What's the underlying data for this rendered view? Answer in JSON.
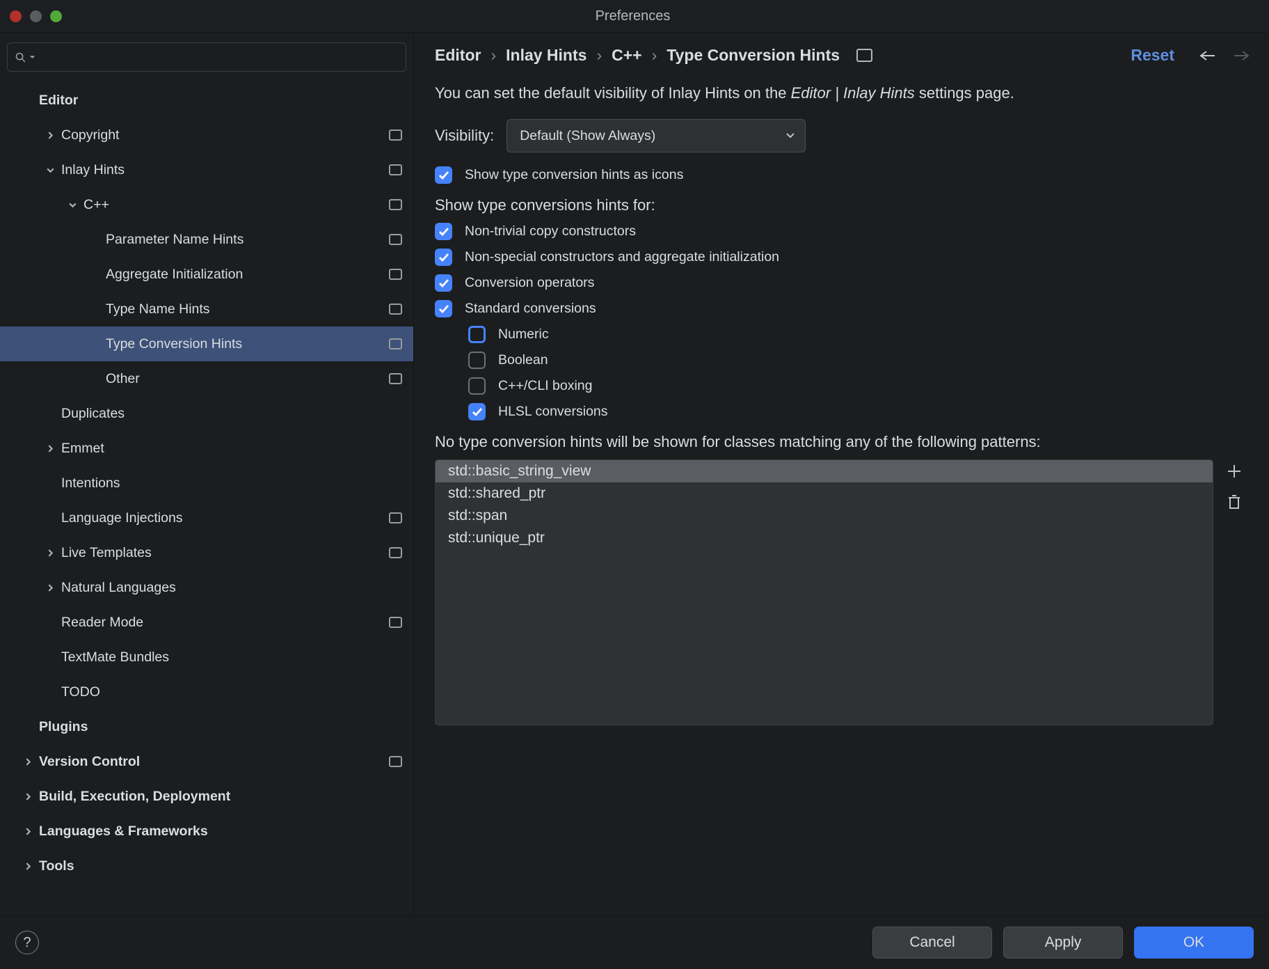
{
  "window": {
    "title": "Preferences"
  },
  "sidebar": {
    "search_placeholder": "",
    "items": [
      {
        "label": "Editor",
        "bold": true,
        "indent": 1,
        "chevron": "none"
      },
      {
        "label": "Copyright",
        "indent": 2,
        "chevron": "right",
        "mod": true
      },
      {
        "label": "Inlay Hints",
        "indent": 2,
        "chevron": "down",
        "mod": true
      },
      {
        "label": "C++",
        "indent": 3,
        "chevron": "down",
        "mod": true
      },
      {
        "label": "Parameter Name Hints",
        "indent": 4,
        "chevron": "none",
        "mod": true
      },
      {
        "label": "Aggregate Initialization",
        "indent": 4,
        "chevron": "none",
        "mod": true
      },
      {
        "label": "Type Name Hints",
        "indent": 4,
        "chevron": "none",
        "mod": true
      },
      {
        "label": "Type Conversion Hints",
        "indent": 4,
        "chevron": "none",
        "mod": true,
        "selected": true
      },
      {
        "label": "Other",
        "indent": 4,
        "chevron": "none",
        "mod": true
      },
      {
        "label": "Duplicates",
        "indent": 2,
        "chevron": "none"
      },
      {
        "label": "Emmet",
        "indent": 2,
        "chevron": "right"
      },
      {
        "label": "Intentions",
        "indent": 2,
        "chevron": "none"
      },
      {
        "label": "Language Injections",
        "indent": 2,
        "chevron": "none",
        "mod": true
      },
      {
        "label": "Live Templates",
        "indent": 2,
        "chevron": "right",
        "mod": true
      },
      {
        "label": "Natural Languages",
        "indent": 2,
        "chevron": "right"
      },
      {
        "label": "Reader Mode",
        "indent": 2,
        "chevron": "none",
        "mod": true
      },
      {
        "label": "TextMate Bundles",
        "indent": 2,
        "chevron": "none"
      },
      {
        "label": "TODO",
        "indent": 2,
        "chevron": "none"
      },
      {
        "label": "Plugins",
        "bold": true,
        "indent": 1,
        "chevron": "none"
      },
      {
        "label": "Version Control",
        "bold": true,
        "indent": 1,
        "chevron": "right",
        "mod": true
      },
      {
        "label": "Build, Execution, Deployment",
        "bold": true,
        "indent": 1,
        "chevron": "right"
      },
      {
        "label": "Languages & Frameworks",
        "bold": true,
        "indent": 1,
        "chevron": "right"
      },
      {
        "label": "Tools",
        "bold": true,
        "indent": 1,
        "chevron": "right"
      }
    ]
  },
  "breadcrumb": [
    "Editor",
    "Inlay Hints",
    "C++",
    "Type Conversion Hints"
  ],
  "reset": "Reset",
  "content": {
    "desc_pre": "You can set the default visibility of Inlay Hints on the ",
    "desc_em": "Editor | Inlay Hints",
    "desc_post": " settings page.",
    "visibility_label": "Visibility:",
    "visibility_value": "Default (Show Always)",
    "show_icons": "Show type conversion hints as icons",
    "show_for": "Show type conversions hints for:",
    "checks": [
      {
        "label": "Non-trivial copy constructors",
        "on": true
      },
      {
        "label": "Non-special constructors and aggregate initialization",
        "on": true
      },
      {
        "label": "Conversion operators",
        "on": true
      },
      {
        "label": "Standard conversions",
        "on": true
      }
    ],
    "subchecks": [
      {
        "label": "Numeric",
        "on": false,
        "hl": true
      },
      {
        "label": "Boolean",
        "on": false
      },
      {
        "label": "C++/CLI boxing",
        "on": false
      },
      {
        "label": "HLSL conversions",
        "on": true
      }
    ],
    "exclude_label": "No type conversion hints will be shown for classes matching any of the following patterns:",
    "patterns": [
      "std::basic_string_view",
      "std::shared_ptr",
      "std::span",
      "std::unique_ptr"
    ]
  },
  "footer": {
    "cancel": "Cancel",
    "apply": "Apply",
    "ok": "OK"
  }
}
